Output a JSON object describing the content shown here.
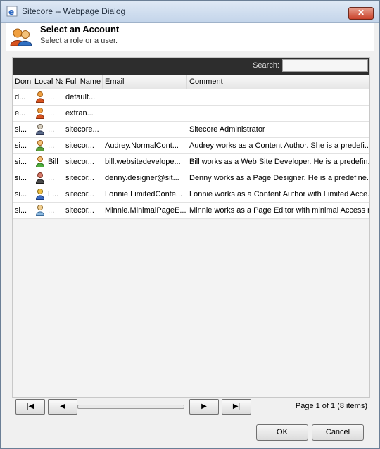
{
  "window": {
    "title": "Sitecore -- Webpage Dialog",
    "close_label": "✕"
  },
  "header": {
    "title": "Select an Account",
    "subtitle": "Select a role or a user."
  },
  "search": {
    "label": "Search:",
    "value": ""
  },
  "columns": [
    "Dom",
    "Local Na",
    "Full Name",
    "Email",
    "Comment"
  ],
  "rows": [
    {
      "domain": "d...",
      "local": "...",
      "full": "default...",
      "email": "",
      "comment": "",
      "icon": "user-orange"
    },
    {
      "domain": "e...",
      "local": "...",
      "full": "extran...",
      "email": "",
      "comment": "",
      "icon": "user-orange"
    },
    {
      "domain": "si...",
      "local": "...",
      "full": "sitecore...",
      "email": "",
      "comment": "Sitecore Administrator",
      "icon": "user-admin"
    },
    {
      "domain": "si...",
      "local": "...",
      "full": "sitecor...",
      "email": "Audrey.NormalCont...",
      "comment": "Audrey works as a Content Author. She is a predefi...",
      "icon": "user-green"
    },
    {
      "domain": "si...",
      "local": "Bill",
      "full": "sitecor...",
      "email": "bill.websitedevelope...",
      "comment": "Bill works as a Web Site Developer. He is a predefin...",
      "icon": "user-green2"
    },
    {
      "domain": "si...",
      "local": "...",
      "full": "sitecor...",
      "email": "denny.designer@sit...",
      "comment": "Denny works as a Page Designer. He is a predefine...",
      "icon": "user-red"
    },
    {
      "domain": "si...",
      "local": "L...",
      "full": "sitecor...",
      "email": "Lonnie.LimitedConte...",
      "comment": "Lonnie works as a Content Author with Limited Acce...",
      "icon": "user-blue"
    },
    {
      "domain": "si...",
      "local": "...",
      "full": "sitecor...",
      "email": "Minnie.MinimalPageE...",
      "comment": "Minnie works as a Page Editor with minimal Access ri...",
      "icon": "user-lightblue"
    }
  ],
  "pager": {
    "first": "|◀",
    "prev": "◀",
    "next": "▶",
    "last": "▶|",
    "info": "Page 1 of 1 (8 items)"
  },
  "buttons": {
    "ok": "OK",
    "cancel": "Cancel"
  }
}
